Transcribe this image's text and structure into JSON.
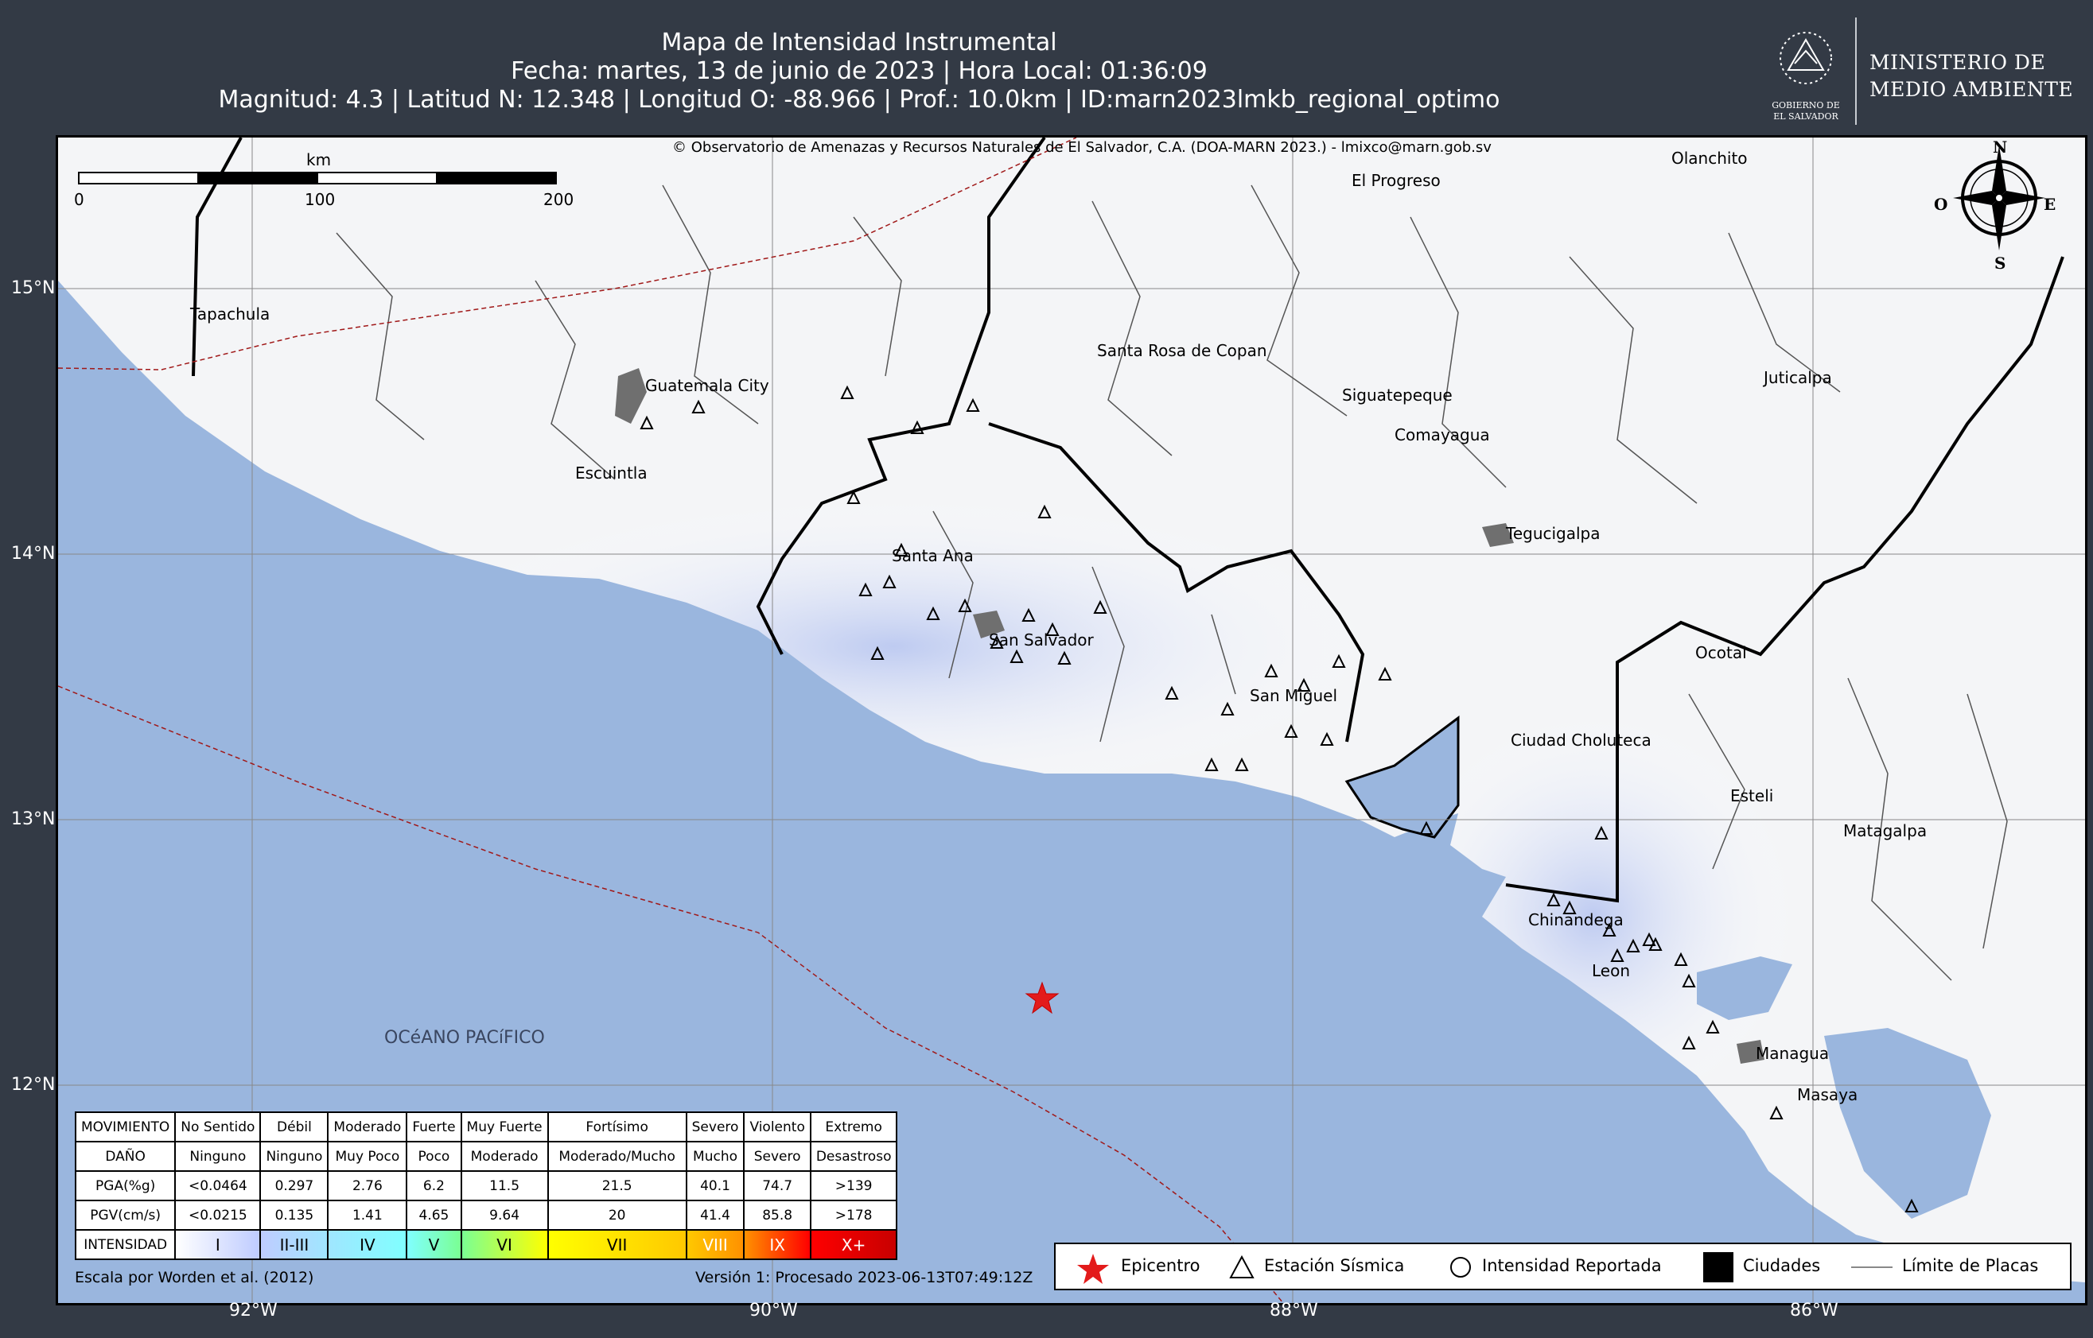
{
  "title": {
    "line1": "Mapa de Intensidad Instrumental",
    "line2": "Fecha: martes, 13 de junio de 2023 | Hora Local: 01:36:09",
    "line3": "Magnitud: 4.3 | Latitud N: 12.348 | Longitud O: -88.966 | Prof.: 10.0km | ID:marn2023lmkb_regional_optimo"
  },
  "ministry": {
    "line1": "MINISTERIO DE",
    "line2": "MEDIO AMBIENTE",
    "seal_text": "GOBIERNO DE EL SALVADOR"
  },
  "map": {
    "copyright": "© Observatorio de Amenazas y Recursos Naturales de El Salvador, C.A. (DOA-MARN 2023.) - lmixco@marn.gob.sv",
    "scale_bar": {
      "unit": "km",
      "ticks": [
        "0",
        "100",
        "200"
      ]
    },
    "compass": {
      "n": "N",
      "s": "S",
      "e": "E",
      "w": "O"
    },
    "lat_labels": [
      "15°N",
      "14°N",
      "13°N",
      "12°N"
    ],
    "lon_labels": [
      "92°W",
      "90°W",
      "88°W",
      "86°W"
    ],
    "ocean_label": "OCéANO PACíFICO",
    "epicenter": {
      "lat": 12.348,
      "lon": -88.966
    },
    "cities": [
      {
        "name": "Tapachula"
      },
      {
        "name": "Guatemala City"
      },
      {
        "name": "Escuintla"
      },
      {
        "name": "Santa Ana"
      },
      {
        "name": "San Salvador"
      },
      {
        "name": "San Miguel"
      },
      {
        "name": "Santa Rosa de Copan"
      },
      {
        "name": "El Progreso"
      },
      {
        "name": "Olanchito"
      },
      {
        "name": "Siguatepeque"
      },
      {
        "name": "Comayagua"
      },
      {
        "name": "Juticalpa"
      },
      {
        "name": "Tegucigalpa"
      },
      {
        "name": "Ocotal"
      },
      {
        "name": "Ciudad Choluteca"
      },
      {
        "name": "Esteli"
      },
      {
        "name": "Matagalpa"
      },
      {
        "name": "Chinandega"
      },
      {
        "name": "Leon"
      },
      {
        "name": "Managua"
      },
      {
        "name": "Masaya"
      }
    ]
  },
  "legend": {
    "rows": [
      {
        "header": "MOVIMIENTO",
        "cells": [
          "No Sentido",
          "Débil",
          "Moderado",
          "Fuerte",
          "Muy Fuerte",
          "Fortísimo",
          "Severo",
          "Violento",
          "Extremo"
        ]
      },
      {
        "header": "DAÑO",
        "cells": [
          "Ninguno",
          "Ninguno",
          "Muy Poco",
          "Poco",
          "Moderado",
          "Moderado/Mucho",
          "Mucho",
          "Severo",
          "Desastroso"
        ]
      },
      {
        "header": "PGA(%g)",
        "cells": [
          "<0.0464",
          "0.297",
          "2.76",
          "6.2",
          "11.5",
          "21.5",
          "40.1",
          "74.7",
          ">139"
        ]
      },
      {
        "header": "PGV(cm/s)",
        "cells": [
          "<0.0215",
          "0.135",
          "1.41",
          "4.65",
          "9.64",
          "20",
          "41.4",
          "85.8",
          ">178"
        ]
      },
      {
        "header": "INTENSIDAD",
        "cells": [
          "I",
          "II-III",
          "IV",
          "V",
          "VI",
          "VII",
          "VIII",
          "IX",
          "X+"
        ]
      }
    ],
    "intensity_colors": [
      "#ffffff",
      "#bfccff",
      "#a0e6ff",
      "#80ffff",
      "#7aff93",
      "#ffff00",
      "#ffc800",
      "#ff9100",
      "#ff0000",
      "#c80000"
    ],
    "scale_credit": "Escala por Worden et al. (2012)",
    "version": "Versión 1: Procesado 2023-06-13T07:49:12Z"
  },
  "symbol_legend": {
    "epicentro": "Epicentro",
    "estacion": "Estación Sísmica",
    "intensidad": "Intensidad Reportada",
    "ciudades": "Ciudades",
    "placas": "Límite de Placas"
  }
}
